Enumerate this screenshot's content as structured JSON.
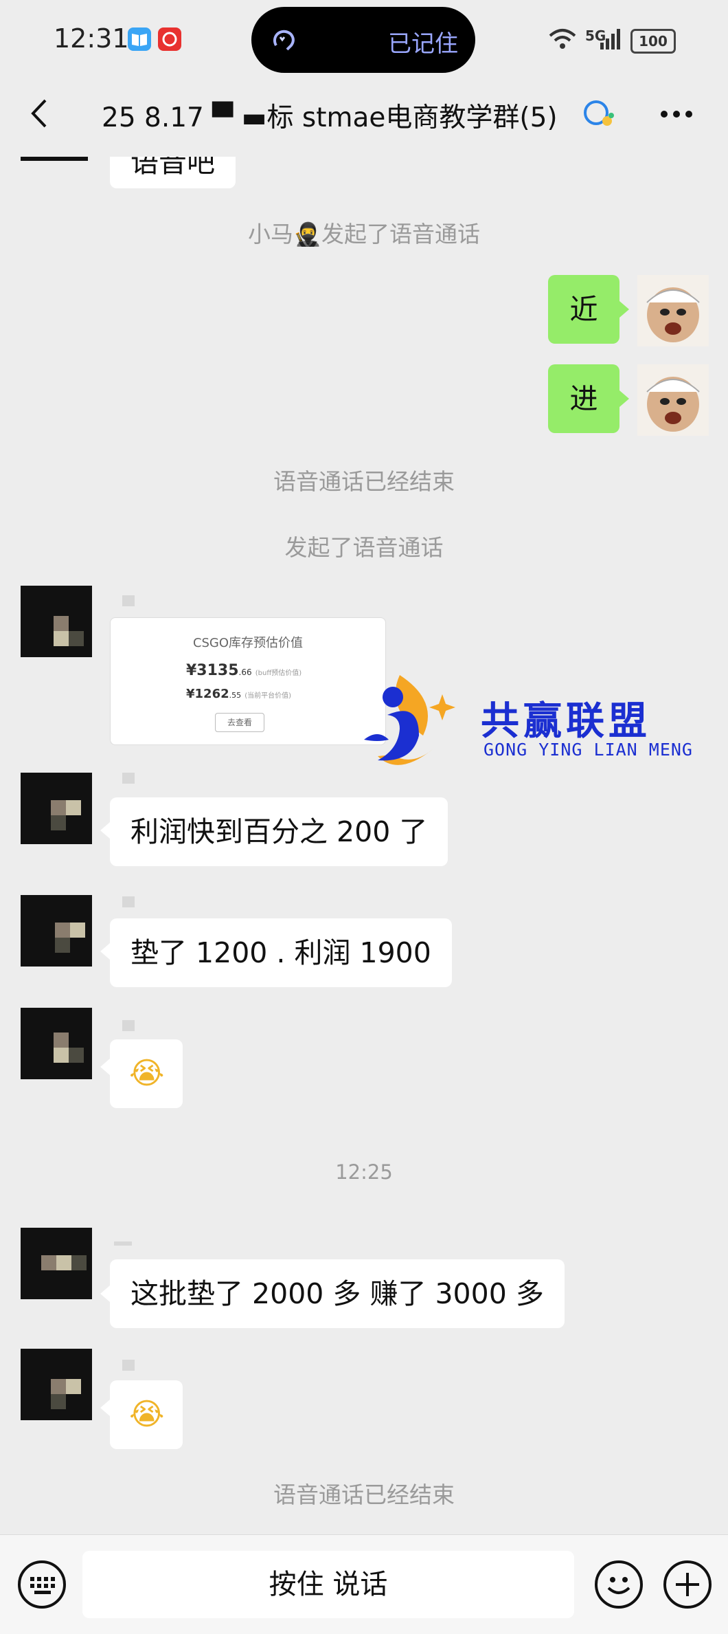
{
  "status_bar": {
    "time": "12:31",
    "island_text": "已记住",
    "network": "5G",
    "battery": "100"
  },
  "header": {
    "title": "25 8.17 ▀ ▬标 stmae电商教学群(5)"
  },
  "messages": {
    "partial_bubble": "语音吧",
    "sys_call_started_1": "小马🥷发起了语音通话",
    "me_msg_1": "近",
    "me_msg_2": "进",
    "sys_call_ended_1": "语音通话已经结束",
    "sys_call_started_2": "发起了语音通话",
    "card_title": "CSGO库存预估价值",
    "card_value_1": "¥3135",
    "card_value_1_decimal": ".66",
    "card_value_1_note": "(buff预估价值)",
    "card_value_2": "¥1262",
    "card_value_2_decimal": ".55",
    "card_value_2_note": "(当前平台价值)",
    "card_button": "去查看",
    "msg_profit_200": "利润快到百分之 200 了",
    "msg_advance_1200": "垫了 1200 . 利润 1900",
    "emoji_laugh_cry_1": "😭",
    "timestamp": "12:25",
    "msg_advance_2000": "这批垫了 2000 多 赚了 3000 多",
    "emoji_laugh_cry_2": "😭",
    "sys_call_ended_2": "语音通话已经结束"
  },
  "watermark": {
    "title": "共赢联盟",
    "subtitle": "GONG YING LIAN MENG"
  },
  "bottom_bar": {
    "talk_button": "按住 说话"
  },
  "colors": {
    "background": "#ededed",
    "my_bubble": "#95ec69",
    "other_bubble": "#ffffff",
    "watermark_blue": "#1b2fd1",
    "watermark_orange": "#f5a623"
  },
  "icons": {
    "back": "back-chevron-icon",
    "more": "more-dots-icon",
    "keyboard": "keyboard-icon",
    "emoji": "emoji-icon",
    "add": "plus-icon"
  }
}
